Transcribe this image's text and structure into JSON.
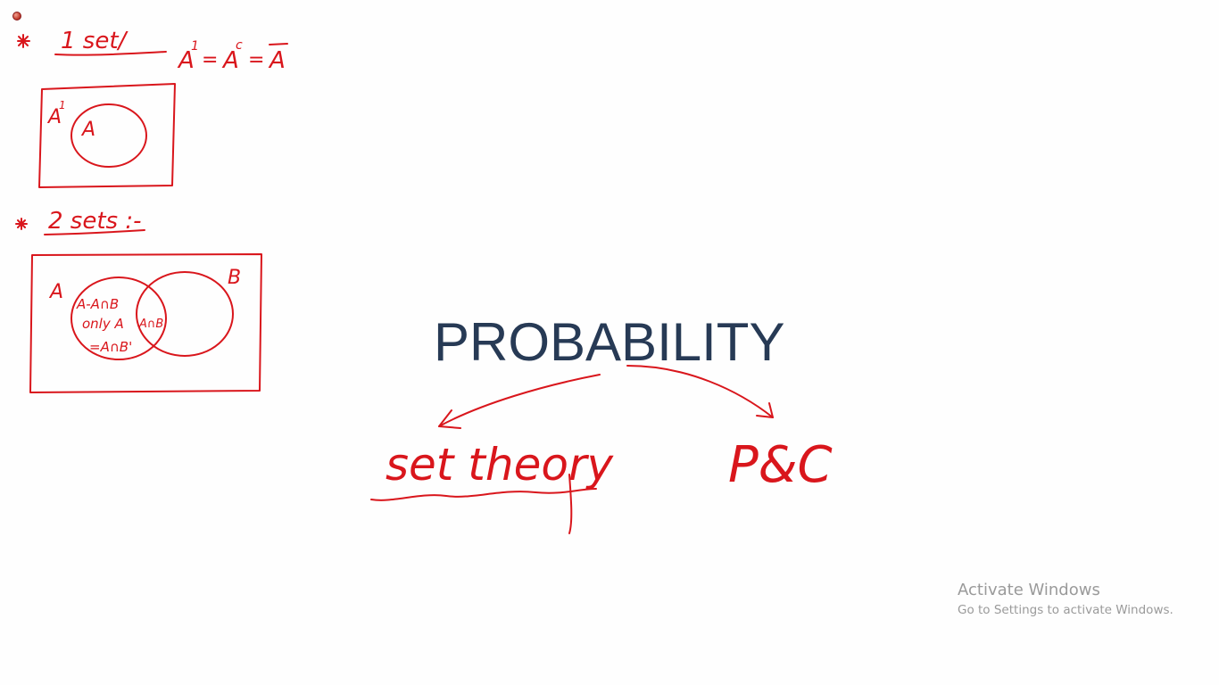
{
  "colors": {
    "ink": "#d9161c",
    "title": "#273a55",
    "watermark": "#9a9a9a",
    "background": "#fefefe"
  },
  "toolbar": {
    "pen_tool_icon": "red-pen-dot-icon"
  },
  "slide": {
    "title": "PROBABILITY"
  },
  "notes": {
    "one_set": {
      "heading": "1 set/",
      "notation": [
        "A",
        "1",
        "=",
        "A",
        "c",
        "=",
        "A"
      ],
      "diagram_labels": {
        "complement": "A",
        "complement_mark": "1",
        "set": "A"
      }
    },
    "two_sets": {
      "heading": "2 sets :-",
      "diagram_labels": {
        "set_a": "A",
        "set_b": "B",
        "a_minus_intersection": "A-A∩B",
        "only_a": "only A",
        "a_intersect_b_complement": "=A∩B'",
        "intersection": "A∩B"
      }
    },
    "branches": {
      "left": "set theory",
      "right": "P&C"
    }
  },
  "watermark": {
    "line1": "Activate Windows",
    "line2": "Go to Settings to activate Windows."
  }
}
